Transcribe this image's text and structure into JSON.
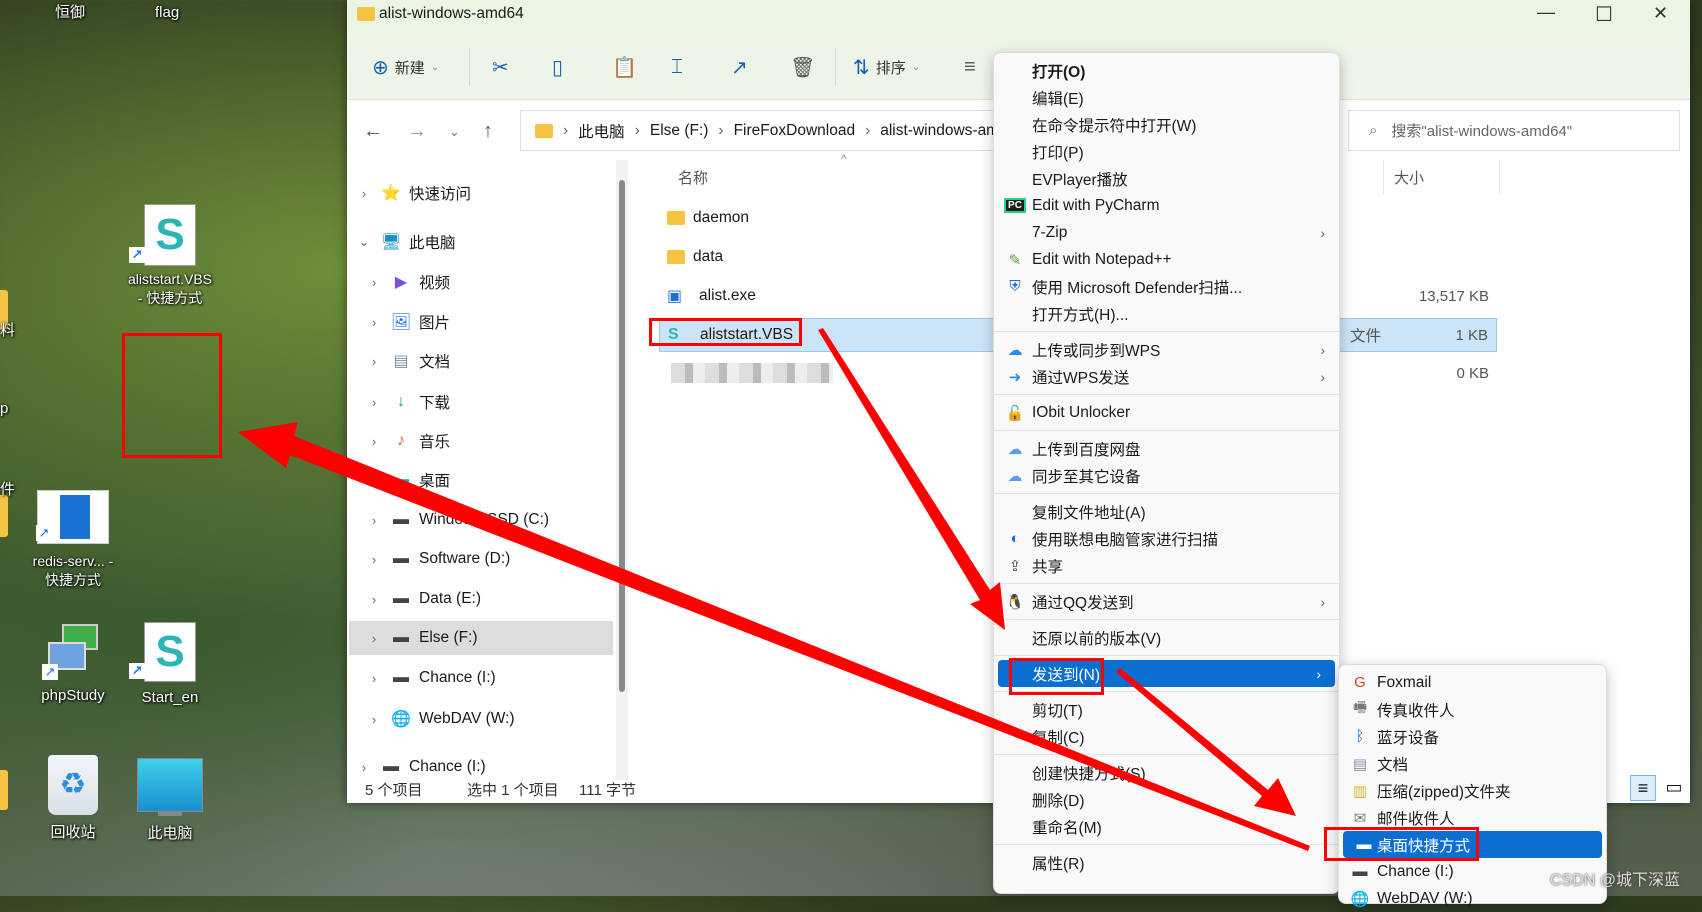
{
  "desktop": {
    "top_labels": [
      "恒御",
      "flag"
    ],
    "icons": [
      {
        "label": "aliststart.VBS - 快捷方式"
      },
      {
        "label": "redis-serv... - 快捷方式"
      },
      {
        "label": "phpStudy"
      },
      {
        "label": "Start_en"
      },
      {
        "label": "回收站"
      },
      {
        "label": "此电脑"
      }
    ],
    "edge_labels": [
      "料",
      "p",
      "件"
    ]
  },
  "window": {
    "title": "alist-windows-amd64",
    "controls": {
      "minimize": "—",
      "maximize": "☐",
      "close": "✕"
    },
    "toolbar": {
      "new_label": "新建",
      "sort_label": "排序"
    },
    "breadcrumb": [
      "此电脑",
      "Else (F:)",
      "FireFoxDownload",
      "alist-windows-am"
    ],
    "search_placeholder": "搜索\"alist-windows-amd64\"",
    "sidebar": [
      {
        "label": "快速访问",
        "icon": "star"
      },
      {
        "label": "此电脑",
        "icon": "computer"
      },
      {
        "label": "视频",
        "icon": "video"
      },
      {
        "label": "图片",
        "icon": "picture"
      },
      {
        "label": "文档",
        "icon": "document"
      },
      {
        "label": "下载",
        "icon": "download"
      },
      {
        "label": "音乐",
        "icon": "music"
      },
      {
        "label": "桌面",
        "icon": "desktop"
      },
      {
        "label": "Windows-SSD (C:)",
        "icon": "drive"
      },
      {
        "label": "Software (D:)",
        "icon": "drive"
      },
      {
        "label": "Data (E:)",
        "icon": "drive"
      },
      {
        "label": "Else (F:)",
        "icon": "drive",
        "selected": true
      },
      {
        "label": "Chance (I:)",
        "icon": "drive"
      },
      {
        "label": "WebDAV (W:)",
        "icon": "network"
      },
      {
        "label": "Chance (I:)",
        "icon": "drive"
      }
    ],
    "columns": {
      "name": "名称",
      "size": "大小"
    },
    "files": [
      {
        "name": "daemon",
        "type": "",
        "size": ""
      },
      {
        "name": "data",
        "type": "",
        "size": ""
      },
      {
        "name": "alist.exe",
        "type": "",
        "size": "13,517 KB"
      },
      {
        "name": "aliststart.VBS",
        "type": "文件",
        "size": "1 KB",
        "selected": true
      },
      {
        "name": "",
        "type": "",
        "size": "0 KB",
        "blurred": true
      }
    ],
    "status": {
      "count": "5 个项目",
      "selected": "选中 1 个项目",
      "bytes": "111 字节"
    }
  },
  "context_menu": {
    "items": [
      {
        "label": "打开(O)",
        "bold": true
      },
      {
        "label": "编辑(E)"
      },
      {
        "label": "在命令提示符中打开(W)"
      },
      {
        "label": "打印(P)"
      },
      {
        "label": "EVPlayer播放"
      },
      {
        "label": "Edit with PyCharm",
        "icon": "pycharm"
      },
      {
        "label": "7-Zip",
        "submenu": true
      },
      {
        "label": "Edit with Notepad++",
        "icon": "notepadpp"
      },
      {
        "label": "使用 Microsoft Defender扫描...",
        "icon": "defender-shield"
      },
      {
        "label": "打开方式(H)..."
      },
      {
        "sep": true
      },
      {
        "label": "上传或同步到WPS",
        "icon": "wps-cloud",
        "submenu": true
      },
      {
        "label": "通过WPS发送",
        "icon": "wps-send",
        "submenu": true
      },
      {
        "sep": true
      },
      {
        "label": "IObit Unlocker",
        "icon": "lock"
      },
      {
        "sep": true
      },
      {
        "label": "上传到百度网盘",
        "icon": "baidu"
      },
      {
        "label": "同步至其它设备",
        "icon": "baidu"
      },
      {
        "sep": true
      },
      {
        "label": "复制文件地址(A)"
      },
      {
        "label": "使用联想电脑管家进行扫描",
        "icon": "lenovo"
      },
      {
        "label": "共享",
        "icon": "share"
      },
      {
        "sep": true
      },
      {
        "label": "通过QQ发送到",
        "icon": "qq",
        "submenu": true
      },
      {
        "sep": true
      },
      {
        "label": "还原以前的版本(V)"
      },
      {
        "sep": true
      },
      {
        "label": "发送到(N)",
        "submenu": true,
        "highlighted": true
      },
      {
        "sep": true
      },
      {
        "label": "剪切(T)"
      },
      {
        "label": "复制(C)"
      },
      {
        "sep": true
      },
      {
        "label": "创建快捷方式(S)"
      },
      {
        "label": "删除(D)"
      },
      {
        "label": "重命名(M)"
      },
      {
        "sep": true
      },
      {
        "label": "属性(R)"
      }
    ]
  },
  "send_to_menu": {
    "items": [
      {
        "label": "Foxmail",
        "icon": "foxmail"
      },
      {
        "label": "传真收件人",
        "icon": "fax"
      },
      {
        "label": "蓝牙设备",
        "icon": "bluetooth"
      },
      {
        "label": "文档",
        "icon": "document"
      },
      {
        "label": "压缩(zipped)文件夹",
        "icon": "zip-folder"
      },
      {
        "label": "邮件收件人",
        "icon": "mail"
      },
      {
        "label": "桌面快捷方式",
        "icon": "desktop",
        "highlighted": true
      },
      {
        "label": "Chance (I:)",
        "icon": "drive"
      },
      {
        "label": "WebDAV (W:)",
        "icon": "network"
      }
    ]
  },
  "watermark": "CSDN @城下深蓝",
  "annotation_color": "#ff0000",
  "accent": "#0a6fd1"
}
